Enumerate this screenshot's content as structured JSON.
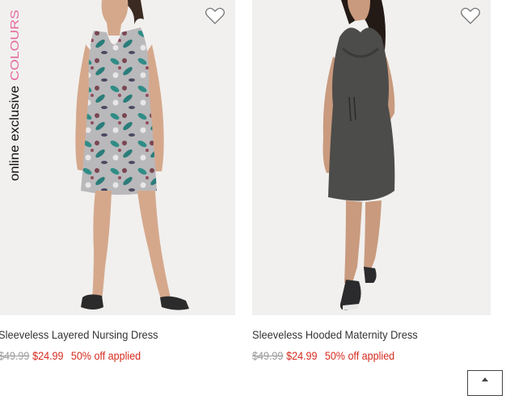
{
  "products": [
    {
      "name": "Sleeveless Layered Nursing Dress",
      "original_price": "$49.99",
      "sale_price": "$24.99",
      "promo": "50% off applied",
      "badge": {
        "prefix": "online exclusive",
        "highlight": "COLOURS"
      },
      "image_icon": "floral-dress-photo"
    },
    {
      "name": "Sleeveless Hooded Maternity Dress",
      "original_price": "$49.99",
      "sale_price": "$24.99",
      "promo": "50% off applied",
      "image_icon": "grey-hooded-dress-photo"
    }
  ],
  "icons": {
    "favorite": "heart-icon",
    "back_to_top": "chevron-up-icon"
  },
  "colors": {
    "sale": "#d52b1e",
    "strike": "#999999",
    "text": "#333333"
  }
}
